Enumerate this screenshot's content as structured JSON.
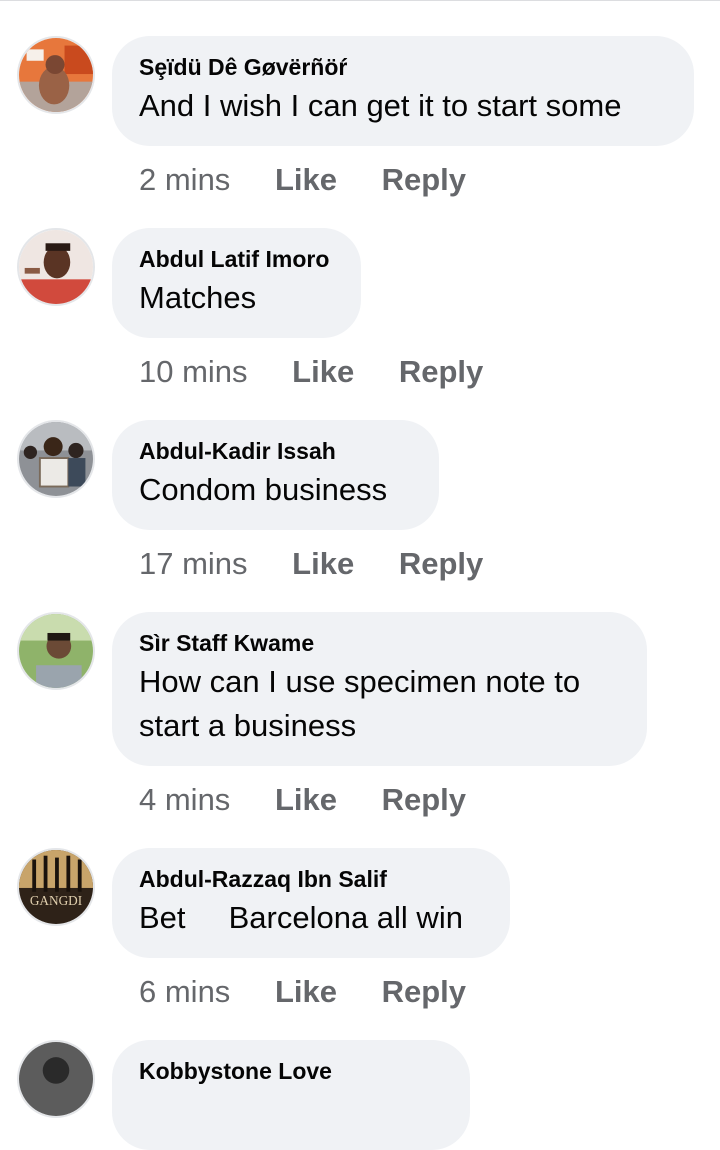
{
  "actions": {
    "like_label": "Like",
    "reply_label": "Reply"
  },
  "comments": [
    {
      "author": "Sȩïdü Dê Gøvërñöŕ",
      "text": "And I wish I can get it to start some",
      "time": "2 mins"
    },
    {
      "author": "Abdul Latif Imoro",
      "text": "Matches",
      "time": "10 mins"
    },
    {
      "author": "Abdul-Kadir Issah",
      "text": "Condom business",
      "time": "17 mins"
    },
    {
      "author": "Sìr Staff Kwame",
      "text": "How can I use specimen note to start a business",
      "time": "4 mins"
    },
    {
      "author": "Abdul-Razzaq Ibn Salif",
      "text": "Bet     Barcelona all win",
      "time": "6 mins"
    },
    {
      "author": "Kobbystone Love",
      "text": "",
      "time": ""
    }
  ],
  "avatars": [
    {
      "icon": "avatar-photo",
      "accent": "#d9572b"
    },
    {
      "icon": "avatar-photo",
      "accent": "#d14a3d"
    },
    {
      "icon": "avatar-photo",
      "accent": "#4f5a66"
    },
    {
      "icon": "avatar-photo",
      "accent": "#6f9a4c"
    },
    {
      "icon": "avatar-photo",
      "accent": "#3a2a1c",
      "logo_text": "GANGDI"
    },
    {
      "icon": "avatar-photo",
      "accent": "#666666"
    }
  ]
}
